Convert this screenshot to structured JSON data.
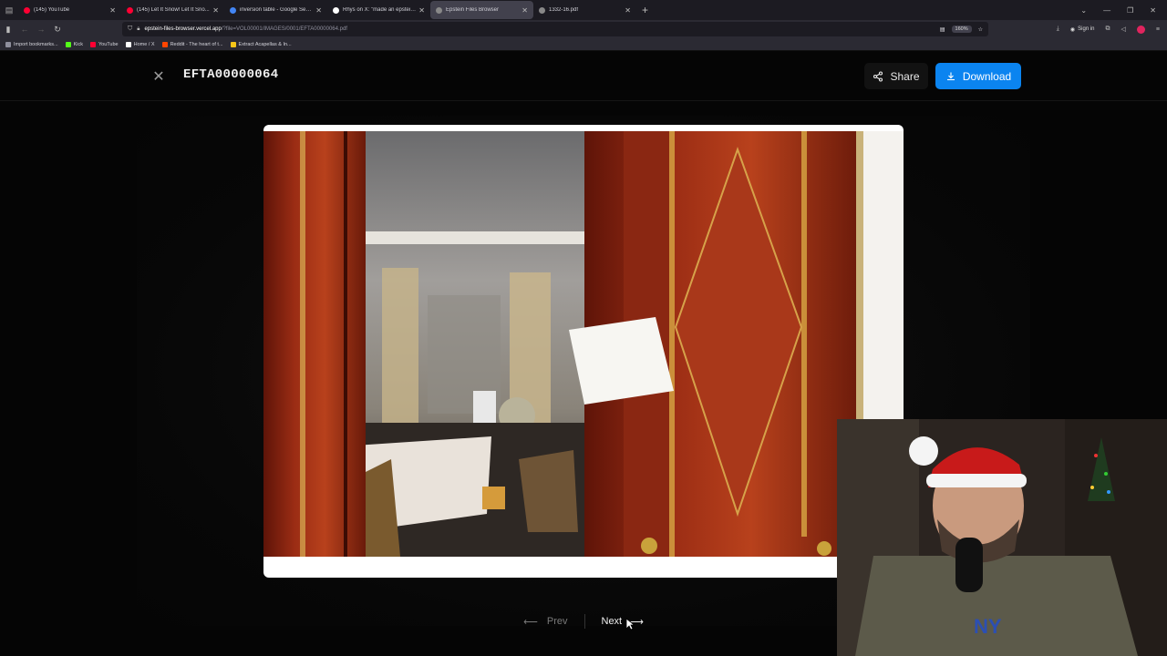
{
  "browser": {
    "tabs": [
      {
        "title": "(145) YouTube",
        "color": "#ff0033",
        "active": false
      },
      {
        "title": "(145) Let It Snow! Let It Sno...",
        "color": "#ff0033",
        "active": false
      },
      {
        "title": "inversion table - Google Search",
        "color": "#4285f4",
        "active": false
      },
      {
        "title": "Rhys on X: \"made an epstein fil...",
        "color": "#ffffff",
        "active": false
      },
      {
        "title": "Epstein Files Browser",
        "color": "#888888",
        "active": true
      },
      {
        "title": "1332-16.pdf",
        "color": "#888888",
        "active": false
      }
    ],
    "new_tab": "+",
    "url_host": "epstein-files-browser.vercel.app",
    "url_path": "/?file=VOL00001/IMAGES/0001/EFTA00000064.pdf",
    "zoom": "160%",
    "sign_in": "Sign in",
    "bookmarks": [
      {
        "label": "Import bookmarks...",
        "color": "#8f8f9d"
      },
      {
        "label": "Kick",
        "color": "#53fc18"
      },
      {
        "label": "YouTube",
        "color": "#ff0033"
      },
      {
        "label": "Home / X",
        "color": "#ffffff"
      },
      {
        "label": "Reddit - The heart of t...",
        "color": "#ff4500"
      },
      {
        "label": "Extract Acapellas & In...",
        "color": "#f5c518"
      }
    ]
  },
  "viewer": {
    "file_name": "EFTA00000064",
    "share_label": "Share",
    "download_label": "Download",
    "prev_label": "Prev",
    "next_label": "Next"
  },
  "colors": {
    "accent": "#0b84f0",
    "background": "#050505"
  }
}
